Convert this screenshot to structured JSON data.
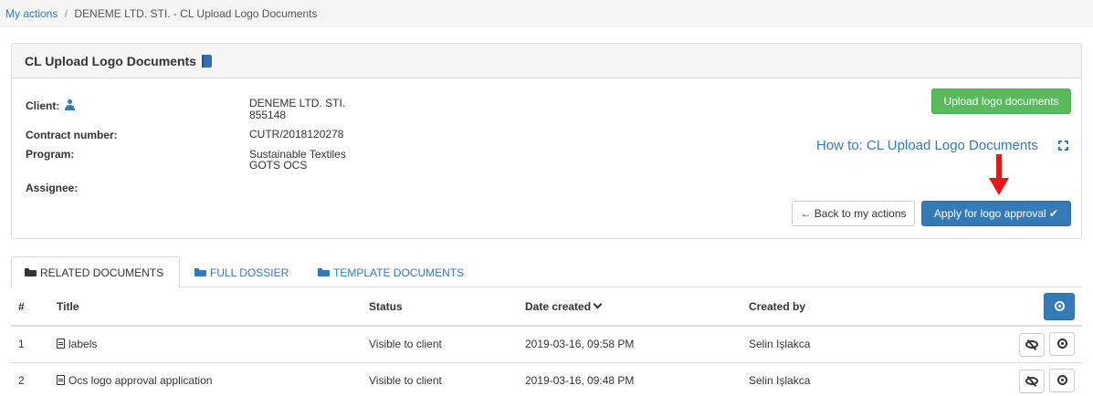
{
  "breadcrumb": {
    "link": "My actions",
    "separator": "/",
    "current": "DENEME LTD. STI. - CL Upload Logo Documents"
  },
  "panel": {
    "title": "CL Upload Logo Documents",
    "client_label": "Client:",
    "client_name": "DENEME LTD. STI.",
    "client_id": "855148",
    "contract_label": "Contract number:",
    "contract_value": "CUTR/2018120278",
    "program_label": "Program:",
    "program_line1": "Sustainable Textiles",
    "program_line2": "GOTS OCS",
    "assignee_label": "Assignee:",
    "upload_button": "Upload logo documents",
    "howto_link": "How to: CL Upload Logo Documents",
    "back_button": "← Back to my actions",
    "apply_button": "Apply for logo approval ✔"
  },
  "tabs": [
    {
      "label": "RELATED DOCUMENTS",
      "active": true
    },
    {
      "label": "FULL DOSSIER",
      "active": false
    },
    {
      "label": "TEMPLATE DOCUMENTS",
      "active": false
    }
  ],
  "table": {
    "headers": {
      "num": "#",
      "title": "Title",
      "status": "Status",
      "date": "Date created",
      "created_by": "Created by"
    },
    "rows": [
      {
        "num": "1",
        "title": "labels",
        "status": "Visible to client",
        "date": "2019-03-16, 09:58 PM",
        "created_by": "Selin Işlakca"
      },
      {
        "num": "2",
        "title": "Ocs logo approval application",
        "status": "Visible to client",
        "date": "2019-03-16, 09:48 PM",
        "created_by": "Selin Işlakca"
      }
    ]
  },
  "colors": {
    "primary": "#337ab7",
    "success": "#5cb85c",
    "annotation_arrow": "#e8151b"
  }
}
